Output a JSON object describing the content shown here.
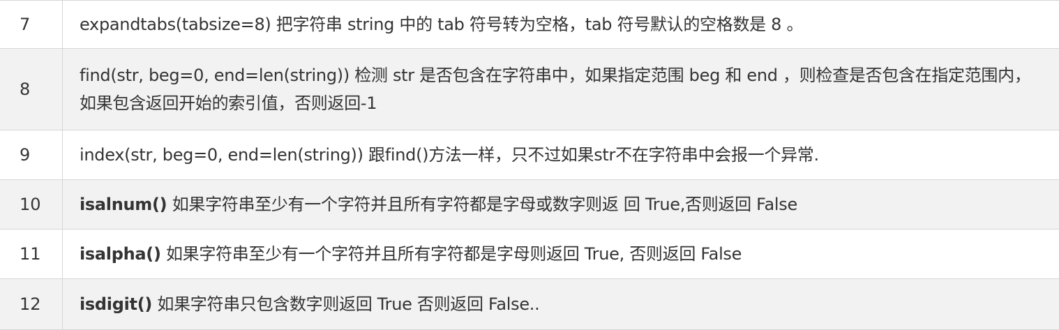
{
  "rows": [
    {
      "num": "7",
      "method": "",
      "text": "expandtabs(tabsize=8) 把字符串 string 中的 tab 符号转为空格，tab 符号默认的空格数是 8 。"
    },
    {
      "num": "8",
      "method": "",
      "text": "find(str, beg=0, end=len(string)) 检测 str 是否包含在字符串中，如果指定范围 beg 和 end ，则检查是否包含在指定范围内，如果包含返回开始的索引值，否则返回-1"
    },
    {
      "num": "9",
      "method": "",
      "text": "index(str, beg=0, end=len(string)) 跟find()方法一样，只不过如果str不在字符串中会报一个异常."
    },
    {
      "num": "10",
      "method": "isalnum()",
      "text": " 如果字符串至少有一个字符并且所有字符都是字母或数字则返 回 True,否则返回 False"
    },
    {
      "num": "11",
      "method": "isalpha()",
      "text": " 如果字符串至少有一个字符并且所有字符都是字母则返回 True, 否则返回 False"
    },
    {
      "num": "12",
      "method": "isdigit()",
      "text": " 如果字符串只包含数字则返回 True 否则返回 False.."
    }
  ]
}
